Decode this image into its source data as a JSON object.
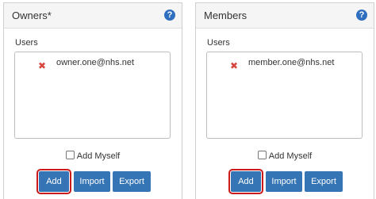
{
  "owners": {
    "title": "Owners*",
    "users_label": "Users",
    "users": [
      "owner.one@nhs.net"
    ],
    "add_myself_label": "Add Myself",
    "buttons": {
      "add": "Add",
      "import": "Import",
      "export": "Export"
    }
  },
  "members": {
    "title": "Members",
    "users_label": "Users",
    "users": [
      "member.one@nhs.net"
    ],
    "add_myself_label": "Add Myself",
    "buttons": {
      "add": "Add",
      "import": "Import",
      "export": "Export"
    }
  },
  "help_icon_text": "?",
  "remove_icon_glyph": "✖",
  "colors": {
    "accent": "#3575b5",
    "help_icon": "#2f6fbf",
    "remove": "#d9453f",
    "highlight": "#cc1a1a"
  }
}
